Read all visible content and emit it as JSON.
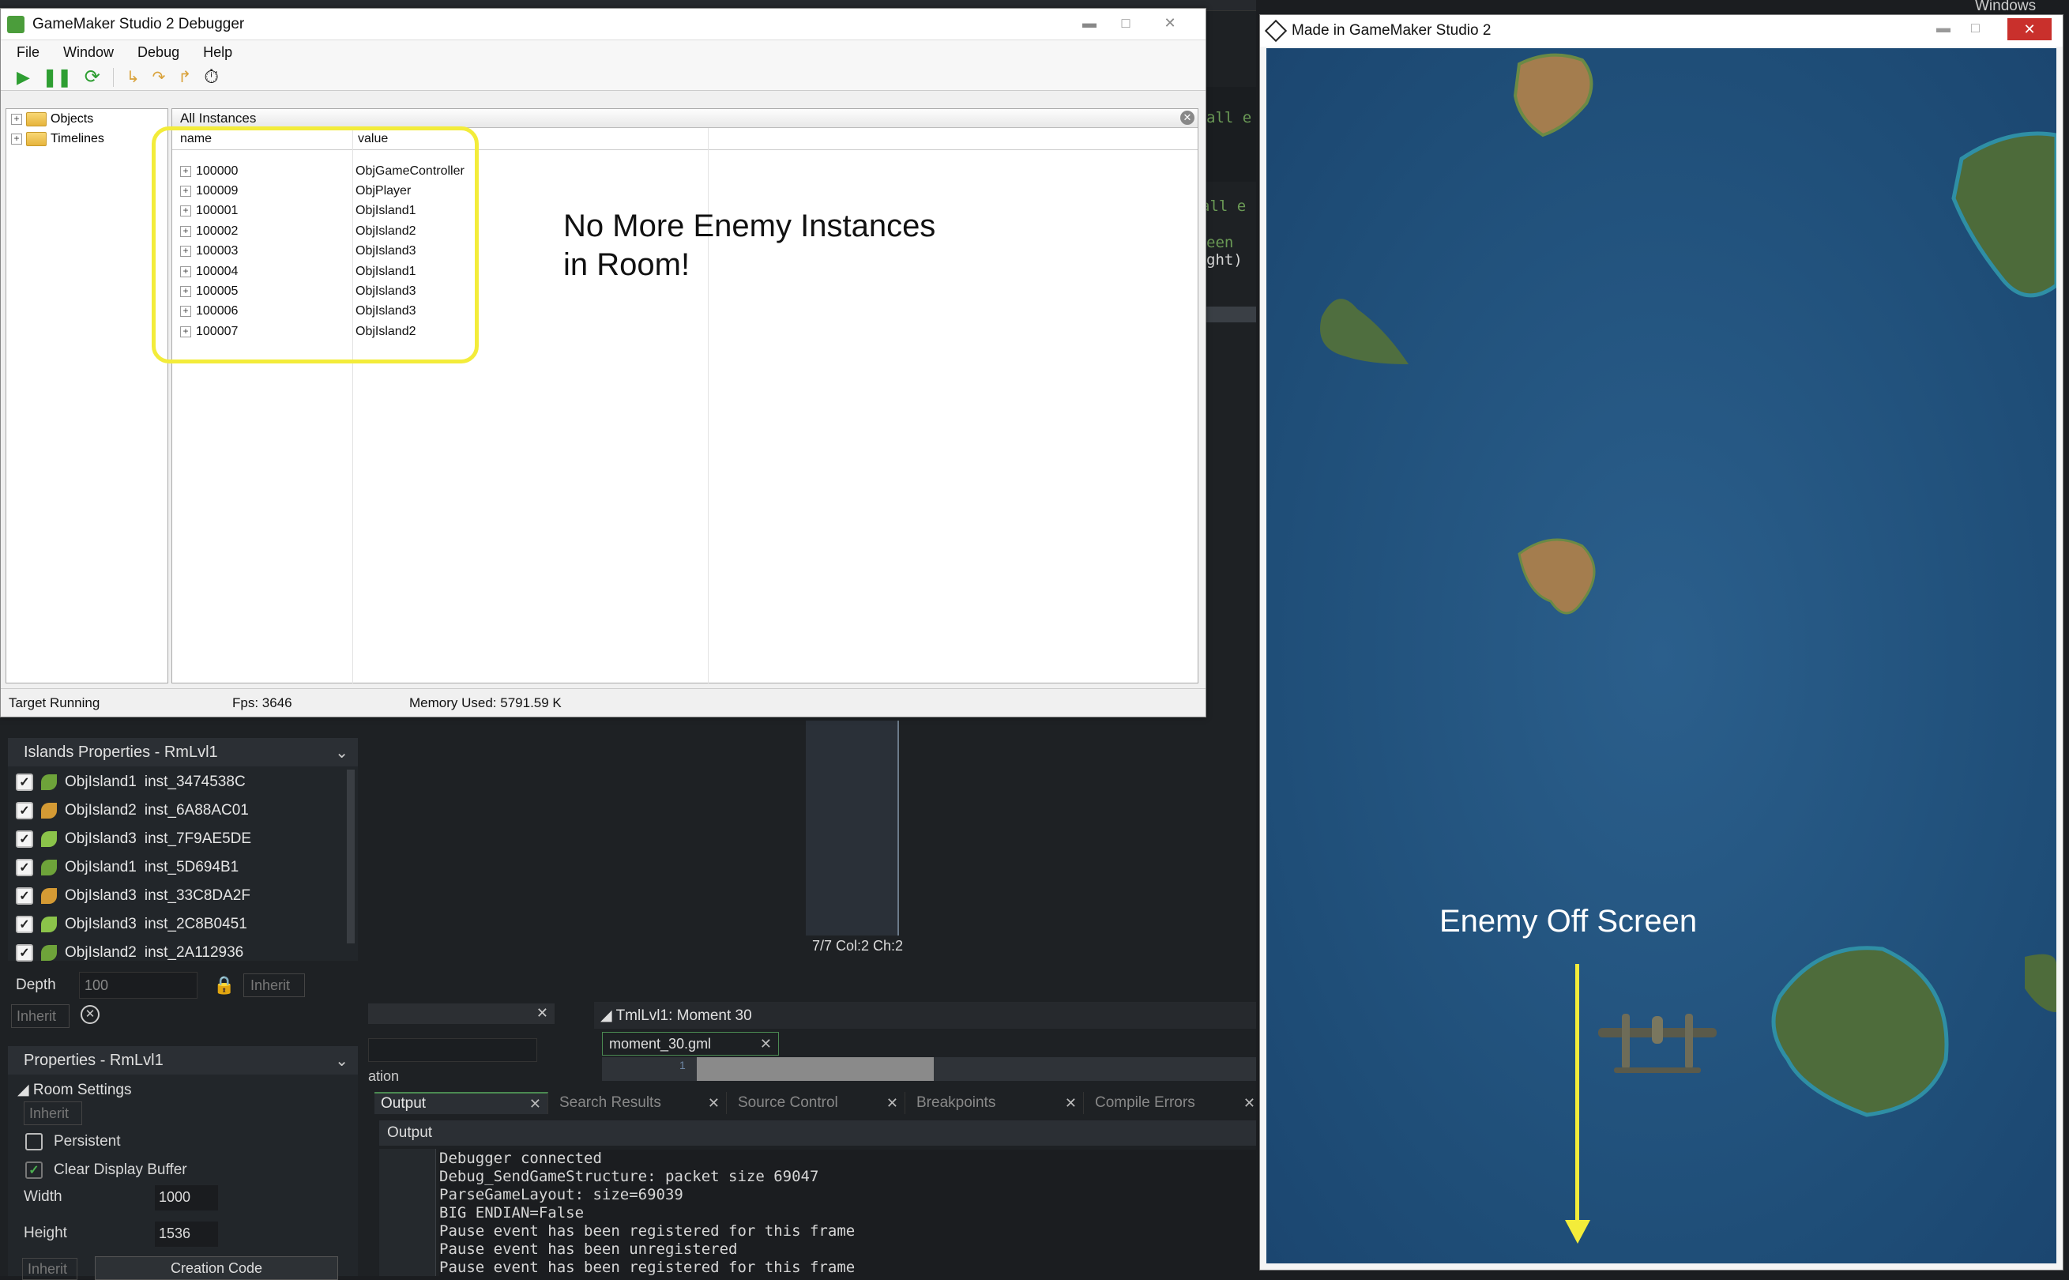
{
  "ide": {
    "islands_panel": {
      "title": "Islands Properties - RmLvl1",
      "items": [
        {
          "object": "ObjIsland1",
          "inst": "inst_3474538C"
        },
        {
          "object": "ObjIsland2",
          "inst": "inst_6A88AC01"
        },
        {
          "object": "ObjIsland3",
          "inst": "inst_7F9AE5DE"
        },
        {
          "object": "ObjIsland1",
          "inst": "inst_5D694B1"
        },
        {
          "object": "ObjIsland3",
          "inst": "inst_33C8DA2F"
        },
        {
          "object": "ObjIsland3",
          "inst": "inst_2C8B0451"
        },
        {
          "object": "ObjIsland2",
          "inst": "inst_2A112936"
        }
      ],
      "depth_label": "Depth",
      "depth_value": "100",
      "inherit_label": "Inherit"
    },
    "room_panel": {
      "title": "Properties - RmLvl1",
      "section": "Room Settings",
      "inherit_label": "Inherit",
      "persistent_label": "Persistent",
      "clear_label": "Clear Display Buffer",
      "width_label": "Width",
      "width_value": "1000",
      "height_label": "Height",
      "height_value": "1536",
      "creation_code_label": "Creation Code"
    },
    "code_fragments": {
      "line1": "all e",
      "line2": "een",
      "line3": "ght)"
    },
    "editor_status": "7/7 Col:2 Ch:2",
    "timeline": {
      "title": "TmlLvl1: Moment 30",
      "tab": "moment_30.gml",
      "line_number": "1",
      "fragment": "ation"
    },
    "output_tabs": [
      "Output",
      "Search Results",
      "Source Control",
      "Breakpoints",
      "Compile Errors"
    ],
    "output_header": "Output",
    "output_lines": [
      "Debugger connected",
      "Debug_SendGameStructure: packet size 69047",
      "ParseGameLayout: size=69039",
      "BIG ENDIAN=False",
      "Pause event has been registered for this frame",
      "Pause event has been unregistered",
      "Pause event has been registered for this frame"
    ],
    "top_right_text": "Windows | V"
  },
  "debugger": {
    "title": "GameMaker Studio 2 Debugger",
    "menu": [
      "File",
      "Window",
      "Debug",
      "Help"
    ],
    "tree": [
      "Objects",
      "Timelines"
    ],
    "grid_caption": "All Instances",
    "col_name": "name",
    "col_value": "value",
    "rows": [
      {
        "name": "100000",
        "value": "ObjGameController"
      },
      {
        "name": "100009",
        "value": "ObjPlayer"
      },
      {
        "name": "100001",
        "value": "ObjIsland1"
      },
      {
        "name": "100002",
        "value": "ObjIsland2"
      },
      {
        "name": "100003",
        "value": "ObjIsland3"
      },
      {
        "name": "100004",
        "value": "ObjIsland1"
      },
      {
        "name": "100005",
        "value": "ObjIsland3"
      },
      {
        "name": "100006",
        "value": "ObjIsland3"
      },
      {
        "name": "100007",
        "value": "ObjIsland2"
      }
    ],
    "status": {
      "state": "Target Running",
      "fps": "Fps: 3646",
      "memory": "Memory Used: 5791.59 K"
    },
    "annotation_line1": "No More Enemy Instances",
    "annotation_line2": "in Room!"
  },
  "game": {
    "title": "Made in GameMaker Studio 2",
    "annotation": "Enemy Off Screen"
  },
  "colors": {
    "highlight": "#f3ec3a",
    "ocean": "#1f4e78"
  }
}
